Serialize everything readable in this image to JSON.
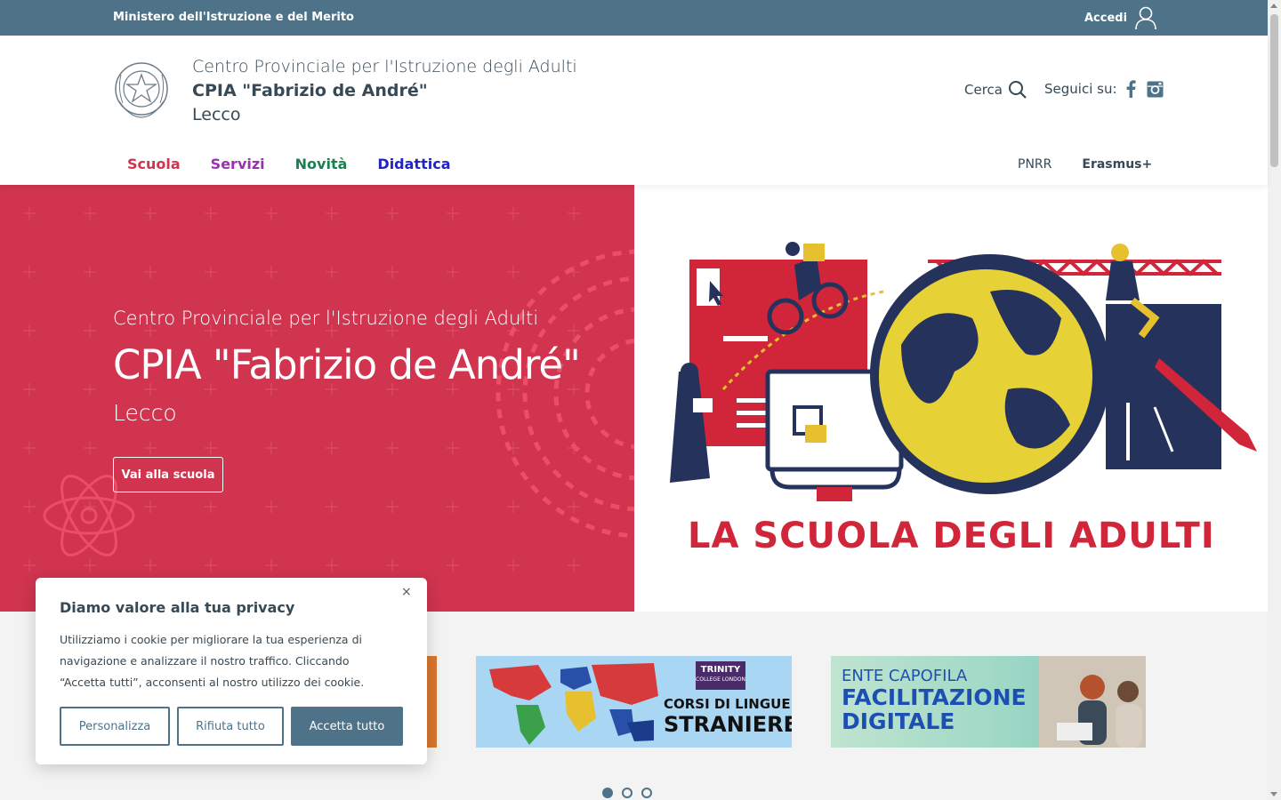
{
  "topbar": {
    "ministry": "Ministero dell'Istruzione e del Merito",
    "login": "Accedi"
  },
  "header": {
    "title_line1": "Centro Provinciale per l'Istruzione degli Adulti",
    "title_line2": "CPIA \"Fabrizio de André\"",
    "title_line3": "Lecco",
    "search": "Cerca",
    "follow": "Seguici su:"
  },
  "nav": {
    "items": [
      "Scuola",
      "Servizi",
      "Novità",
      "Didattica"
    ],
    "secondary": [
      "PNRR",
      "Erasmus+"
    ]
  },
  "hero": {
    "subtitle": "Centro Provinciale per l'Istruzione degli Adulti",
    "title": "CPIA \"Fabrizio de André\"",
    "city": "Lecco",
    "cta": "Vai alla scuola",
    "slogan": "LA SCUOLA DEGLI ADULTI"
  },
  "banners": {
    "trinity_badge_line1": "TRINITY",
    "trinity_badge_line2": "COLLEGE LONDON",
    "lingue_line1": "CORSI DI LINGUE",
    "lingue_line2": "STRANIERE",
    "facil_line1": "ENTE CAPOFILA",
    "facil_line2": "FACILITAZIONE",
    "facil_line3": "DIGITALE"
  },
  "cookie": {
    "title": "Diamo valore alla tua privacy",
    "text": "Utilizziamo i cookie per migliorare la tua esperienza di navigazione e analizzare il nostro traffico. Cliccando “Accetta tutti”, acconsenti al nostro utilizzo dei cookie.",
    "customize": "Personalizza",
    "reject": "Rifiuta tutto",
    "accept": "Accetta tutto",
    "close": "×"
  },
  "carousel": {
    "active": 1,
    "count": 3
  },
  "colors": {
    "topbar": "#4e7389",
    "hero": "#d1344f",
    "accent": "#4e7389"
  }
}
